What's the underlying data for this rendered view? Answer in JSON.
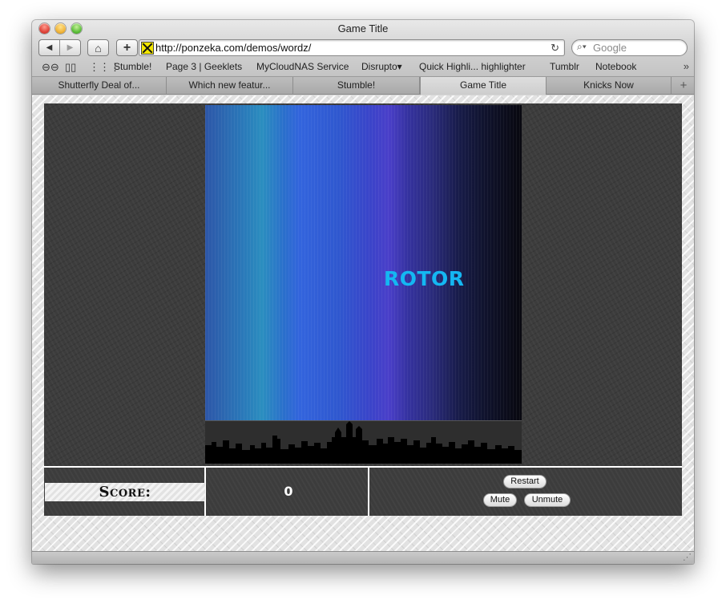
{
  "window": {
    "title": "Game Title"
  },
  "toolbar": {
    "back_icon": "back-arrow-icon",
    "forward_icon": "forward-arrow-icon",
    "home_icon": "home-icon",
    "add_icon": "plus-icon",
    "url": "http://ponzeka.com/demos/wordz/",
    "reload_icon": "reload-icon",
    "search_placeholder": "Google"
  },
  "bookmarks": {
    "items": [
      {
        "label": "Stumble!"
      },
      {
        "label": "Page 3 | Geeklets"
      },
      {
        "label": "MyCloudNAS Service"
      },
      {
        "label": "Disrupto▾"
      },
      {
        "label": "Quick Highli... highlighter"
      },
      {
        "label": "Tumblr"
      },
      {
        "label": "Notebook"
      }
    ],
    "overflow": "»"
  },
  "tabs": [
    {
      "label": "Shutterfly Deal of...",
      "active": false
    },
    {
      "label": "Which new featur...",
      "active": false
    },
    {
      "label": "Stumble!",
      "active": false
    },
    {
      "label": "Game Title",
      "active": true
    },
    {
      "label": "Knicks Now",
      "active": false
    }
  ],
  "tab_add": "+",
  "game": {
    "word": "ROTOR",
    "score_label": "Score:",
    "score_value": "0",
    "buttons": {
      "restart": "Restart",
      "mute": "Mute",
      "unmute": "Unmute"
    }
  },
  "colors": {
    "word": "#14b7f2",
    "panel": "#3c3c3c"
  }
}
